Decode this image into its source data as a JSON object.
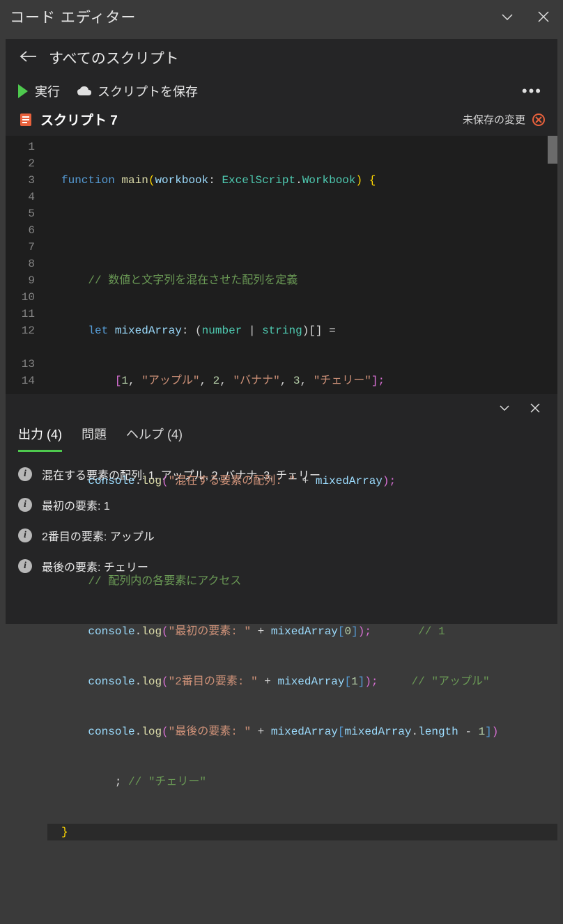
{
  "titlebar": {
    "title": "コード エディター"
  },
  "breadcrumb": {
    "label": "すべてのスクリプト"
  },
  "toolbar": {
    "run_label": "実行",
    "save_label": "スクリプトを保存"
  },
  "script": {
    "name": "スクリプト 7",
    "unsaved_label": "未保存の変更"
  },
  "editor": {
    "line_numbers": [
      "1",
      "2",
      "3",
      "4",
      "5",
      "6",
      "7",
      "8",
      "9",
      "10",
      "11",
      "12",
      "",
      "13",
      "14"
    ]
  },
  "code": {
    "l1": {
      "fn_kw": "function",
      "fn_name": "main",
      "paren_open": "(",
      "param": "workbook",
      "colon": ": ",
      "type1": "ExcelScript",
      "dot": ".",
      "type2": "Workbook",
      "paren_close": ") ",
      "brace": "{"
    },
    "l3": {
      "comment": "// 数値と文字列を混在させた配列を定義"
    },
    "l4": {
      "let_kw": "let",
      "var": " mixedArray",
      "colon": ": (",
      "t1": "number",
      "pipe": " | ",
      "t2": "string",
      "close": ")[] ="
    },
    "l5": {
      "open": "[",
      "n1": "1",
      "c1": ", ",
      "s1": "\"アップル\"",
      "c2": ", ",
      "n2": "2",
      "c3": ", ",
      "s2": "\"バナナ\"",
      "c4": ", ",
      "n3": "3",
      "c5": ", ",
      "s3": "\"チェリー\"",
      "close": "];"
    },
    "l7": {
      "obj": "console",
      "dot": ".",
      "fn": "log",
      "open": "(",
      "str": "\"混在する要素の配列: \"",
      "plus": " + ",
      "var": "mixedArray",
      "close": ");"
    },
    "l9": {
      "comment": "// 配列内の各要素にアクセス"
    },
    "l10": {
      "obj": "console",
      "dot": ".",
      "fn": "log",
      "open": "(",
      "str": "\"最初の要素: \"",
      "plus": " + ",
      "var": "mixedArray",
      "bopen": "[",
      "idx": "0",
      "bclose": "]",
      "close": ");",
      "cmt": "// 1"
    },
    "l11": {
      "obj": "console",
      "dot": ".",
      "fn": "log",
      "open": "(",
      "str": "\"2番目の要素: \"",
      "plus": " + ",
      "var": "mixedArray",
      "bopen": "[",
      "idx": "1",
      "bclose": "]",
      "close": ");",
      "cmt": "// \"アップル\""
    },
    "l12": {
      "obj": "console",
      "dot": ".",
      "fn": "log",
      "open": "(",
      "str": "\"最後の要素: \"",
      "plus": " + ",
      "var": "mixedArray",
      "bopen": "[",
      "var2": "mixedArray",
      "dot2": ".",
      "prop": "length",
      "minus": " - ",
      "one": "1",
      "bclose": "]",
      "close": ")"
    },
    "l12b": {
      "semi": "; ",
      "cmt": "// \"チェリー\""
    },
    "l13": {
      "brace": "}"
    }
  },
  "bottom": {
    "tabs": {
      "output": "出力 (4)",
      "problems": "問題",
      "help": "ヘルプ (4)"
    },
    "output_items": [
      "混在する要素の配列:  1, アップル, 2, バナナ, 3, チェリー",
      "最初の要素:  1",
      "2番目の要素:  アップル",
      "最後の要素:  チェリー"
    ]
  }
}
